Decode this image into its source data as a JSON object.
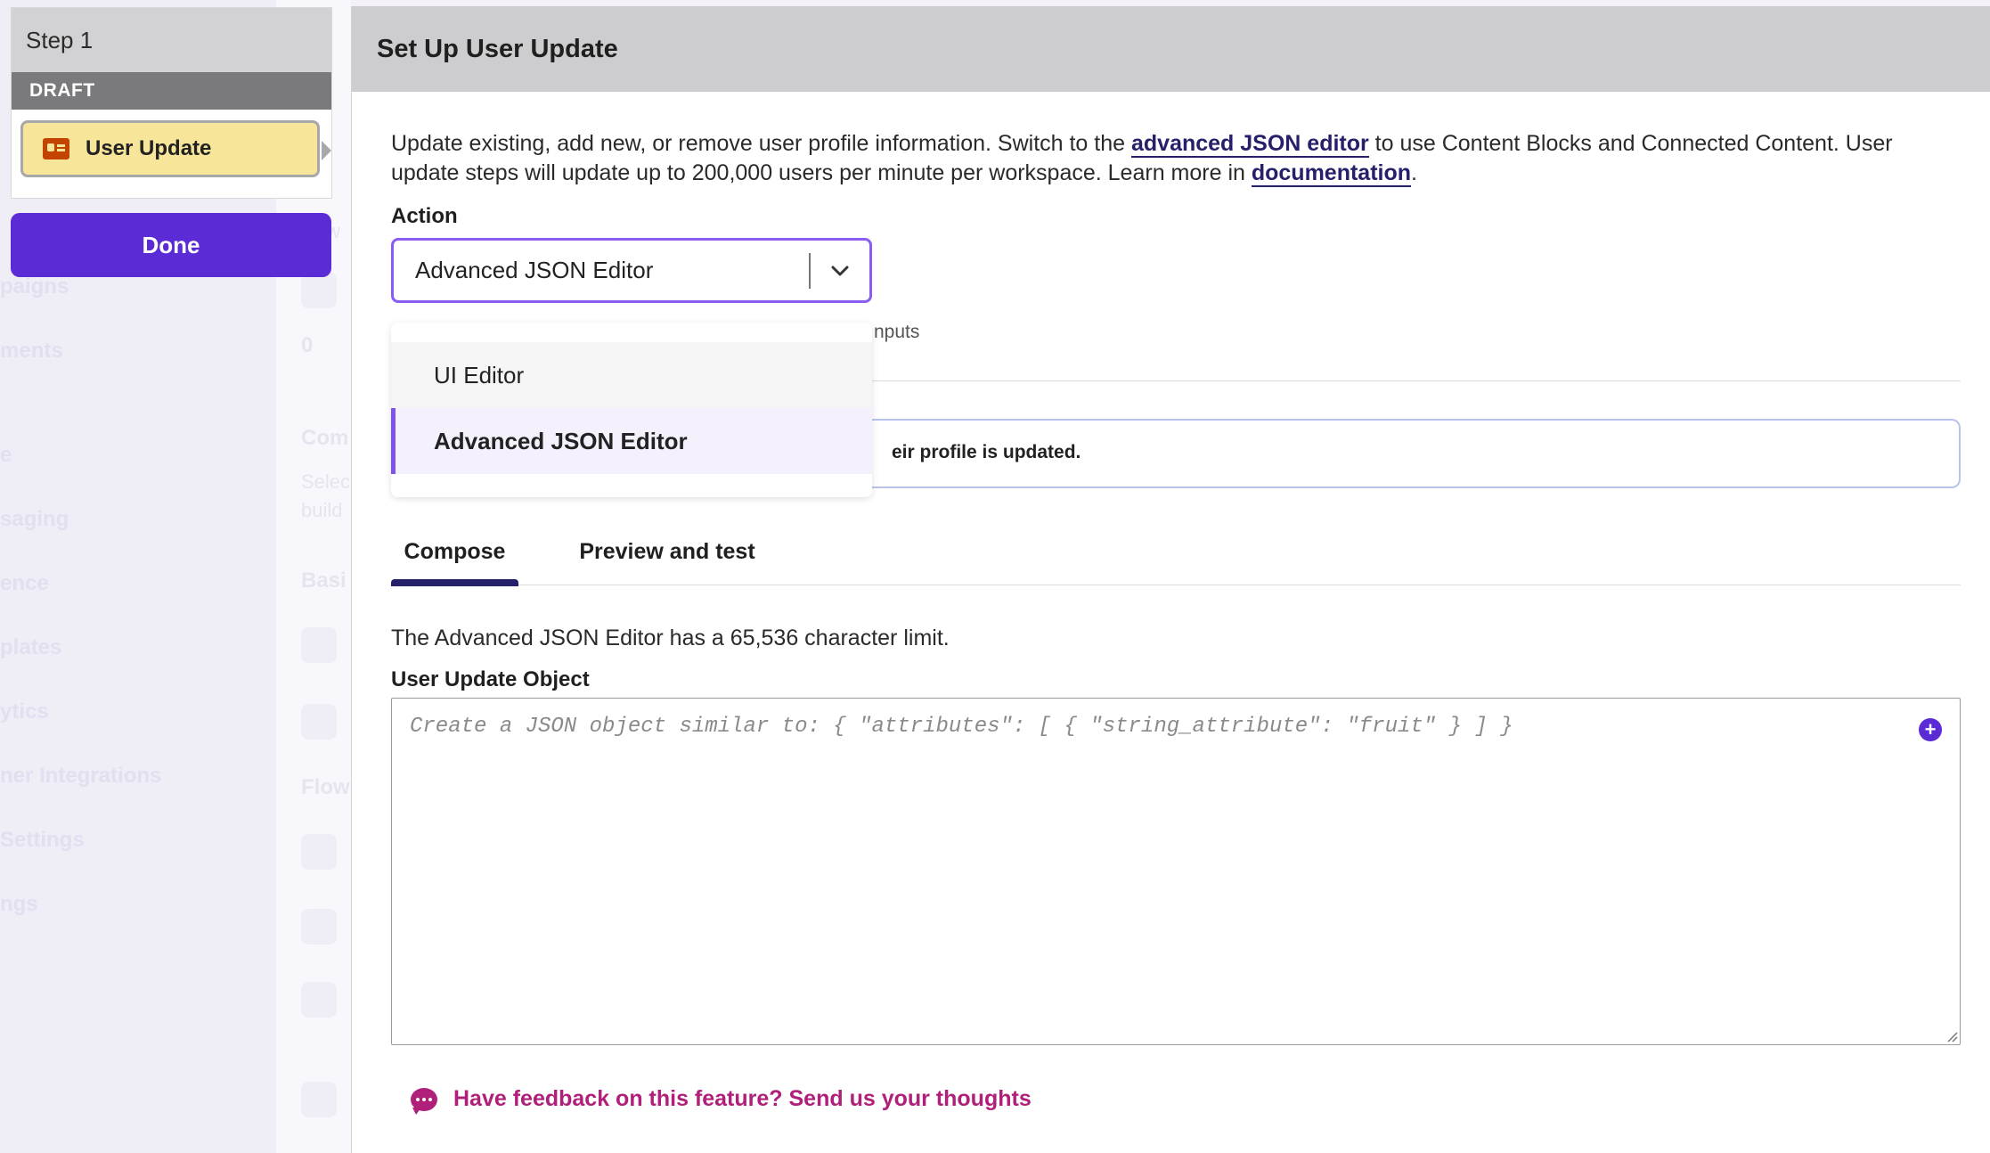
{
  "background": {
    "nav_items": [
      "paigns",
      "ments",
      "e",
      "saging",
      "ence",
      "plates",
      "ytics",
      "ner Integrations",
      "Settings",
      "ngs"
    ],
    "fragments": [
      "Com",
      "Selec",
      "build",
      "Basi",
      "Flow",
      "New",
      "0"
    ]
  },
  "step_panel": {
    "step_label": "Step 1",
    "status": "DRAFT",
    "step_name": "User Update",
    "done_label": "Done"
  },
  "modal": {
    "title": "Set Up User Update",
    "intro_part1": "Update existing, add new, or remove user profile information. Switch to the ",
    "intro_link1": "advanced JSON editor",
    "intro_part2": " to use Content Blocks and Connected Content. User update steps will update up to 200,000 users per minute per workspace. Learn more in ",
    "intro_link2": "documentation",
    "intro_part3": "."
  },
  "action": {
    "label": "Action",
    "selected": "Advanced JSON Editor",
    "options": [
      "UI Editor",
      "Advanced JSON Editor"
    ]
  },
  "partial_inputs": "nputs",
  "info_text": "eir profile is updated.",
  "tabs": [
    "Compose",
    "Preview and test"
  ],
  "editor": {
    "limit_text": "The Advanced JSON Editor has a 65,536 character limit.",
    "field_label": "User Update Object",
    "placeholder": "Create a JSON object similar to: { \"attributes\": [ { \"string_attribute\": \"fruit\" } ] }",
    "value": ""
  },
  "feedback": {
    "label": "Have feedback on this feature? Send us your thoughts"
  },
  "colors": {
    "accent": "#5b2bd6",
    "link": "#26206b",
    "feedback": "#b01f7a",
    "draft_chip": "#f7e59a"
  }
}
